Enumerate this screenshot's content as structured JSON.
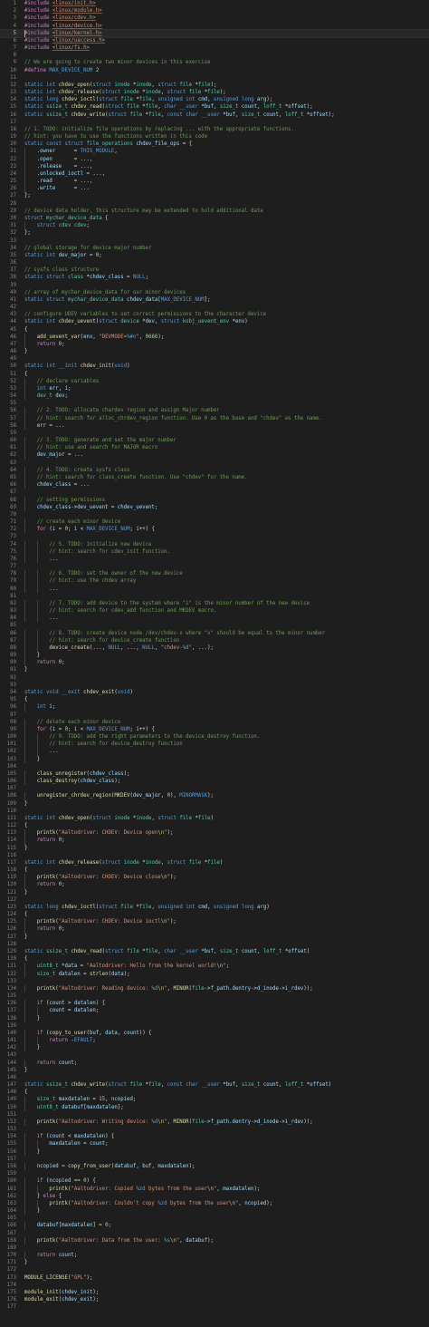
{
  "editor": {
    "cursor_line": 5,
    "lines": [
      "#include <linux/init.h>",
      "#include <linux/module.h>",
      "#include <linux/cdev.h>",
      "#include <linux/device.h>",
      "#include <linux/kernel.h>",
      "#include <linux/uaccess.h>",
      "#include <linux/fs.h>",
      "",
      "// We are going to create two minor devices in this exercise",
      "#define MAX_DEVICE_NUM 2",
      "",
      "static int chdev_open(struct inode *inode, struct file *file);",
      "static int chdev_release(struct inode *inode, struct file *file);",
      "static long chdev_ioctl(struct file *file, unsigned int cmd, unsigned long arg);",
      "static ssize_t chdev_read(struct file *file, char __user *buf, size_t count, loff_t *offset);",
      "static ssize_t chdev_write(struct file *file, const char __user *buf, size_t count, loff_t *offset);",
      "",
      "// 1. TODO: initialize file operations by replacing ... with the appropriate functions.",
      "// hint: you have to use the functions written in this code",
      "static const struct file_operations chdev_file_ops = {",
      "    .owner      = THIS_MODULE,",
      "    .open       = ...,",
      "    .release    = ...,",
      "    .unlocked_ioctl = ...,",
      "    .read       = ...,",
      "    .write      = ...",
      "};",
      "",
      "// device data holder, this structure may be extended to hold additional data",
      "struct mychar_device_data {",
      "    struct cdev cdev;",
      "};",
      "",
      "// global storage for device major number",
      "static int dev_major = 0;",
      "",
      "// sysfs class structure",
      "static struct class *chdev_class = NULL;",
      "",
      "// array of mychar_device_data for our minor devices",
      "static struct mychar_device_data chdev_data[MAX_DEVICE_NUM];",
      "",
      "// configure UDEV variables to set correct permissions to the character device",
      "static int chdev_uevent(struct device *dev, struct kobj_uevent_env *env)",
      "{",
      "    add_uevent_var(env, \"DEVMODE=%#o\", 0666);",
      "    return 0;",
      "}",
      "",
      "static int __init chdev_init(void)",
      "{",
      "    // declare variables",
      "    int err, i;",
      "    dev_t dev;",
      "",
      "    // 2. TODO: allocate chardev region and assign Major number",
      "    // hint: search for alloc_chrdev_region function. Use 0 as the base and \"chdev\" as the name.",
      "    err = ...",
      "",
      "    // 3. TODO: generate and set the major number",
      "    // hint: use and search for MAJOR macro",
      "    dev_major = ...",
      "",
      "    // 4. TODO: create sysfs class",
      "    // hint: search for class_create function. Use \"chdev\" for the name.",
      "    chdev_class = ...",
      "",
      "    // setting permissions",
      "    chdev_class->dev_uevent = chdev_uevent;",
      "",
      "    // create each minor device",
      "    for (i = 0; i < MAX_DEVICE_NUM; i++) {",
      "",
      "        // 5. TODO: initialize new device",
      "        // hint: search for cdev_init function.",
      "        ...",
      "",
      "        // 6. TODO: set the owner of the new device",
      "        // hint: use the chdev array",
      "        ...",
      "",
      "        // 7. TODO: add device to the system where \"i\" is the minor number of the new device",
      "        // hint: search for cdev_add function and MKDEV macro.",
      "        ...",
      "",
      "        // 8. TODO: create device node /dev/chdev-x where \"x\" should be equal to the minor number",
      "        // hint: search for device_create function",
      "        device_create(..., NULL, ..., NULL, \"chdev-%d\", ...);",
      "    }",
      "    return 0;",
      "}",
      "",
      "",
      "static void __exit chdev_exit(void)",
      "{",
      "    int i;",
      "",
      "    // delete each minor device",
      "    for (i = 0; i < MAX_DEVICE_NUM; i++) {",
      "        // 9. TODO: add the right parameters to the device_destroy function.",
      "        // hint: search for device_destroy function",
      "        ...",
      "    }",
      "",
      "    class_unregister(chdev_class);",
      "    class_destroy(chdev_class);",
      "",
      "    unregister_chrdev_region(MKDEV(dev_major, 0), MINORMASK);",
      "}",
      "",
      "static int chdev_open(struct inode *inode, struct file *file)",
      "{",
      "    printk(\"Aaltodriver: CHDEV: Device open\\n\");",
      "    return 0;",
      "}",
      "",
      "static int chdev_release(struct inode *inode, struct file *file)",
      "{",
      "    printk(\"Aaltodriver: CHDEV: Device close\\n\");",
      "    return 0;",
      "}",
      "",
      "static long chdev_ioctl(struct file *file, unsigned int cmd, unsigned long arg)",
      "{",
      "    printk(\"Aaltodriver: CHDEV: Device ioctl\\n\");",
      "    return 0;",
      "}",
      "",
      "static ssize_t chdev_read(struct file *file, char __user *buf, size_t count, loff_t *offset)",
      "{",
      "    uint8_t *data = \"Aaltodriver: Hello from the kernel world!\\n\";",
      "    size_t datalen = strlen(data);",
      "",
      "    printk(\"Aaltodriver: Reading device: %d\\n\", MINOR(file->f_path.dentry->d_inode->i_rdev));",
      "",
      "    if (count > datalen) {",
      "        count = datalen;",
      "    }",
      "",
      "    if (copy_to_user(buf, data, count)) {",
      "        return -EFAULT;",
      "    }",
      "",
      "    return count;",
      "}",
      "",
      "static ssize_t chdev_write(struct file *file, const char __user *buf, size_t count, loff_t *offset)",
      "{",
      "    size_t maxdatalen = 15, ncopied;",
      "    uint8_t databuf[maxdatalen];",
      "",
      "    printk(\"Aaltodriver: Writing device: %d\\n\", MINOR(file->f_path.dentry->d_inode->i_rdev));",
      "",
      "    if (count < maxdatalen) {",
      "        maxdatalen = count;",
      "    }",
      "",
      "    ncopied = copy_from_user(databuf, buf, maxdatalen);",
      "",
      "    if (ncopied == 0) {",
      "        printk(\"Aaltodriver: Copied %zd bytes from the user\\n\", maxdatalen);",
      "    } else {",
      "        printk(\"Aaltodriver: Couldn't copy %zd bytes from the user\\n\", ncopied);",
      "    }",
      "",
      "    databuf[maxdatalen] = 0;",
      "",
      "    printk(\"Aaltodriver: Data from the user: %s\\n\", databuf);",
      "",
      "    return count;",
      "}",
      "",
      "MODULE_LICENSE(\"GPL\");",
      "",
      "module_init(chdev_init);",
      "module_exit(chdev_exit);",
      ""
    ]
  }
}
